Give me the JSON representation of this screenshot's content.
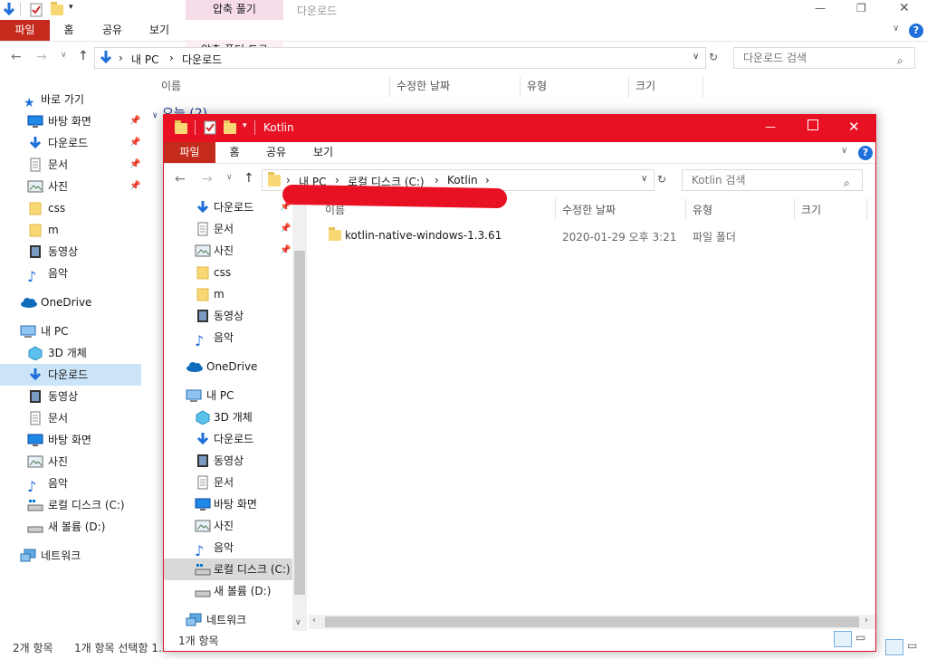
{
  "bg_window": {
    "context_tab": "압축 풀기",
    "folder_name": "다운로드",
    "ribbon_tabs": [
      "파일",
      "홈",
      "공유",
      "보기"
    ],
    "context_subtab": "압축 폴더 도구",
    "address": {
      "crumbs": [
        "내 PC",
        "다운로드"
      ]
    },
    "search_placeholder": "다운로드 검색",
    "columns": [
      "이름",
      "수정한 날짜",
      "유형",
      "크기"
    ],
    "group_header": "오늘 (2)",
    "nav": [
      {
        "label": "바로 가기",
        "icon": "star-icon",
        "pinned": false
      },
      {
        "label": "바탕 화면",
        "icon": "desktop-icon",
        "pinned": true
      },
      {
        "label": "다운로드",
        "icon": "download-arrow-icon",
        "pinned": true
      },
      {
        "label": "문서",
        "icon": "document-icon",
        "pinned": true
      },
      {
        "label": "사진",
        "icon": "pictures-icon",
        "pinned": true
      },
      {
        "label": "css",
        "icon": "folder-icon",
        "pinned": false
      },
      {
        "label": "m",
        "icon": "folder-icon",
        "pinned": false
      },
      {
        "label": "동영상",
        "icon": "video-icon",
        "pinned": false
      },
      {
        "label": "음악",
        "icon": "music-icon",
        "pinned": false
      },
      {
        "label": "OneDrive",
        "icon": "cloud-icon",
        "pinned": false
      },
      {
        "label": "내 PC",
        "icon": "computer-icon",
        "pinned": false
      },
      {
        "label": "3D 개체",
        "icon": "cube-icon",
        "pinned": false
      },
      {
        "label": "다운로드",
        "icon": "download-arrow-icon",
        "pinned": false,
        "selected": true
      },
      {
        "label": "동영상",
        "icon": "video-icon",
        "pinned": false
      },
      {
        "label": "문서",
        "icon": "document-icon",
        "pinned": false
      },
      {
        "label": "바탕 화면",
        "icon": "desktop-icon",
        "pinned": false
      },
      {
        "label": "사진",
        "icon": "pictures-icon",
        "pinned": false
      },
      {
        "label": "음악",
        "icon": "music-icon",
        "pinned": false
      },
      {
        "label": "로컬 디스크 (C:)",
        "icon": "drive-icon",
        "pinned": false
      },
      {
        "label": "새 볼륨 (D:)",
        "icon": "drive-icon",
        "pinned": false
      },
      {
        "label": "네트워크",
        "icon": "network-icon",
        "pinned": false
      }
    ],
    "status": {
      "count": "2개 항목",
      "selected": "1개 항목 선택함 1.53MB"
    }
  },
  "fg_window": {
    "title": "Kotlin",
    "ribbon_tabs": [
      "파일",
      "홈",
      "공유",
      "보기"
    ],
    "address": {
      "crumbs": [
        "내 PC",
        "로컬 디스크 (C:)",
        "Kotlin"
      ]
    },
    "search_placeholder": "Kotlin 검색",
    "columns": [
      "이름",
      "수정한 날짜",
      "유형",
      "크기"
    ],
    "files": [
      {
        "name": "kotlin-native-windows-1.3.61",
        "date": "2020-01-29 오후 3:21",
        "type": "파일 폴더",
        "size": ""
      }
    ],
    "nav": [
      {
        "label": "다운로드",
        "icon": "download-arrow-icon",
        "pinned": true
      },
      {
        "label": "문서",
        "icon": "document-icon",
        "pinned": true
      },
      {
        "label": "사진",
        "icon": "pictures-icon",
        "pinned": true
      },
      {
        "label": "css",
        "icon": "folder-icon",
        "pinned": false
      },
      {
        "label": "m",
        "icon": "folder-icon",
        "pinned": false
      },
      {
        "label": "동영상",
        "icon": "video-icon",
        "pinned": false
      },
      {
        "label": "음악",
        "icon": "music-icon",
        "pinned": false
      },
      {
        "label": "OneDrive",
        "icon": "cloud-icon",
        "pinned": false
      },
      {
        "label": "내 PC",
        "icon": "computer-icon",
        "pinned": false
      },
      {
        "label": "3D 개체",
        "icon": "cube-icon",
        "pinned": false
      },
      {
        "label": "다운로드",
        "icon": "download-arrow-icon",
        "pinned": false
      },
      {
        "label": "동영상",
        "icon": "video-icon",
        "pinned": false
      },
      {
        "label": "문서",
        "icon": "document-icon",
        "pinned": false
      },
      {
        "label": "바탕 화면",
        "icon": "desktop-icon",
        "pinned": false
      },
      {
        "label": "사진",
        "icon": "pictures-icon",
        "pinned": false
      },
      {
        "label": "음악",
        "icon": "music-icon",
        "pinned": false
      },
      {
        "label": "로컬 디스크 (C:)",
        "icon": "drive-icon",
        "pinned": false,
        "selected": true
      },
      {
        "label": "새 볼륨 (D:)",
        "icon": "drive-icon",
        "pinned": false
      },
      {
        "label": "네트워크",
        "icon": "network-icon",
        "pinned": false
      }
    ],
    "status": {
      "count": "1개 항목"
    }
  },
  "colors": {
    "accent_red": "#e81123",
    "file_tab": "#c42b1c",
    "selection": "#cce4f7",
    "folder": "#f8d775"
  }
}
